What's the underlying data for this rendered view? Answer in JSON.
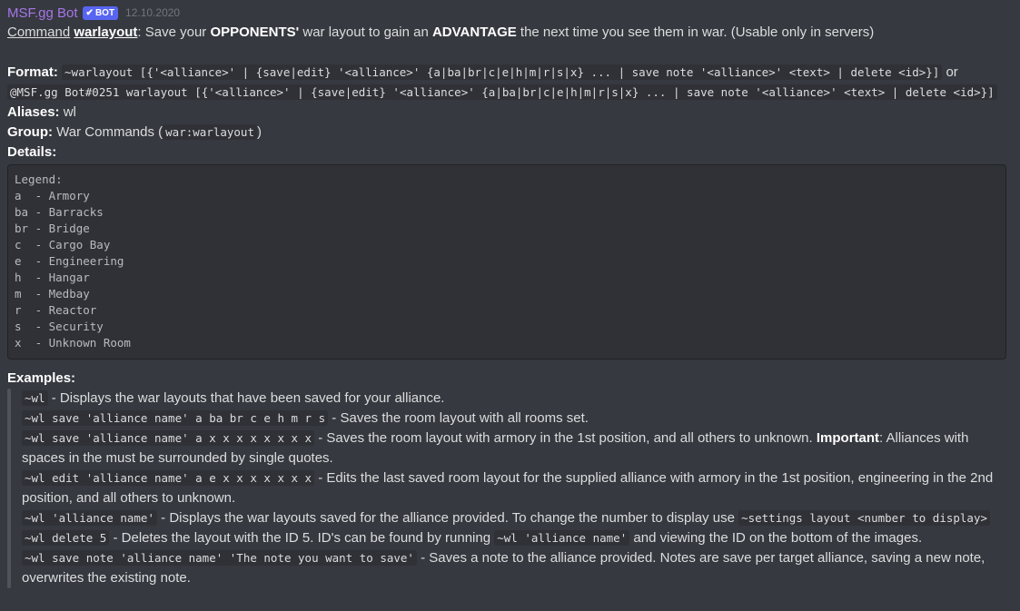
{
  "message": {
    "author": "MSF.gg Bot",
    "badge": "BOT",
    "timestamp": "12.10.2020",
    "command_prefix": "Command",
    "command_name": "warlayout",
    "desc_a": ": Save your ",
    "desc_b1": "OPPONENTS'",
    "desc_c": " war layout to gain an ",
    "desc_b2": "ADVANTAGE",
    "desc_d": " the next time you see them in war. (Usable only in servers)",
    "format_label": "Format:",
    "format_code1": "~warlayout [{'<alliance>' | {save|edit} '<alliance>' {a|ba|br|c|e|h|m|r|s|x} ... | save note '<alliance>' <text> | delete <id>}]",
    "format_or": " or",
    "format_code2": "@MSF.gg Bot#0251 warlayout [{'<alliance>' | {save|edit} '<alliance>' {a|ba|br|c|e|h|m|r|s|x} ... | save note '<alliance>' <text> | delete <id>}]",
    "aliases_label": "Aliases:",
    "aliases_value": " wl",
    "group_label": "Group:",
    "group_value": " War Commands (",
    "group_code": "war:warlayout",
    "group_close": ")",
    "details_label": "Details:",
    "legend": "Legend:\na  - Armory\nba - Barracks\nbr - Bridge\nc  - Cargo Bay\ne  - Engineering\nh  - Hangar\nm  - Medbay\nr  - Reactor\ns  - Security\nx  - Unknown Room",
    "examples_label": "Examples:",
    "ex1_code": "~wl",
    "ex1_text": " - Displays the war layouts that have been saved for your alliance.",
    "ex2_code": "~wl save 'alliance name' a ba br c e h m r s",
    "ex2_text": " - Saves the room layout with all rooms set.",
    "ex3_code": "~wl save 'alliance name' a x x x x x x x x",
    "ex3_text": " - Saves the room layout with armory in the 1st position, and all others to unknown. ",
    "ex3_bold": "Important",
    "ex3_text2": ": Alliances with",
    "ex3_text3": "spaces in the must be surrounded by single quotes.",
    "ex4_code": "~wl edit 'alliance name' a e x x x x x x x",
    "ex4_text": " - Edits the last saved room layout for the supplied alliance with armory in the 1st position, engineering in the 2nd",
    "ex4_text2": "position, and all others to unknown.",
    "ex5_code": "~wl 'alliance name'",
    "ex5_text": " - Displays the war layouts saved for the alliance provided. To change the number to display use ",
    "ex5_code2": "~settings layout <number to display>",
    "ex6_code": "~wl delete 5",
    "ex6_text": " - Deletes the layout with the ID 5. ID's can be found by running ",
    "ex6_code2": "~wl 'alliance name'",
    "ex6_text2": " and viewing the ID on the bottom of the images.",
    "ex7_code": "~wl save note 'alliance name' 'The note you want to save'",
    "ex7_text": " - Saves a note to the alliance provided. Notes are save per target alliance, saving a new note,",
    "ex7_text2": "overwrites the existing note."
  }
}
